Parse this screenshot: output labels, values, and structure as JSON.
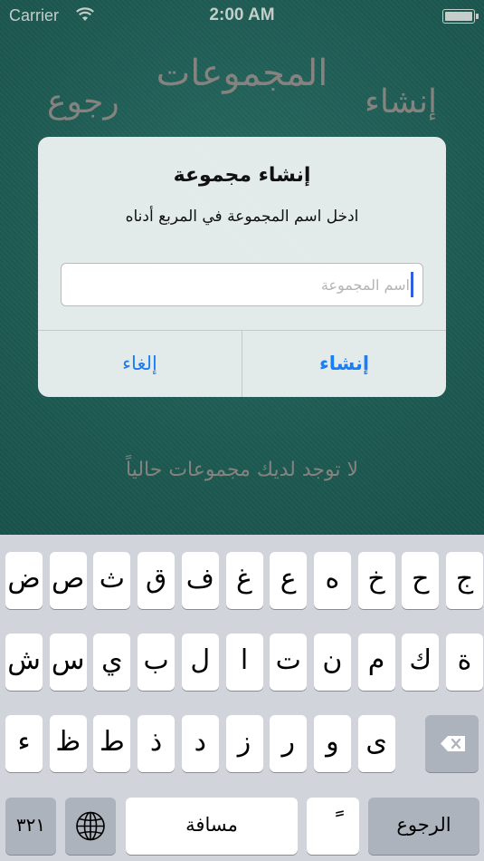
{
  "status": {
    "carrier": "Carrier",
    "time": "2:00 AM"
  },
  "nav": {
    "title": "المجموعات",
    "left": "رجوع",
    "right": "إنشاء"
  },
  "empty_message": "لا توجد لديك مجموعات حالياً",
  "alert": {
    "title": "إنشاء مجموعة",
    "message": "ادخل اسم المجموعة في المربع أدناه",
    "input_placeholder": "اسم المجموعة",
    "input_value": "",
    "cancel_label": "إلغاء",
    "create_label": "إنشاء"
  },
  "keyboard": {
    "row1": [
      "ض",
      "ص",
      "ث",
      "ق",
      "ف",
      "غ",
      "ع",
      "ه",
      "خ",
      "ح",
      "ج"
    ],
    "row2": [
      "ش",
      "س",
      "ي",
      "ب",
      "ل",
      "ا",
      "ت",
      "ن",
      "م",
      "ك",
      "ة"
    ],
    "row3": [
      "ء",
      "ظ",
      "ط",
      "ذ",
      "د",
      "ز",
      "ر",
      "و",
      "ى"
    ],
    "numbers_label": "٣٢١",
    "space_label": "مسافة",
    "diacritic_label": "ً",
    "return_label": "الرجوع",
    "icons": {
      "globe": "globe-icon",
      "delete": "backspace-icon"
    }
  },
  "colors": {
    "accent": "#1a7ef6",
    "background": "#1e5e55",
    "keyboard": "#d1d5db"
  }
}
